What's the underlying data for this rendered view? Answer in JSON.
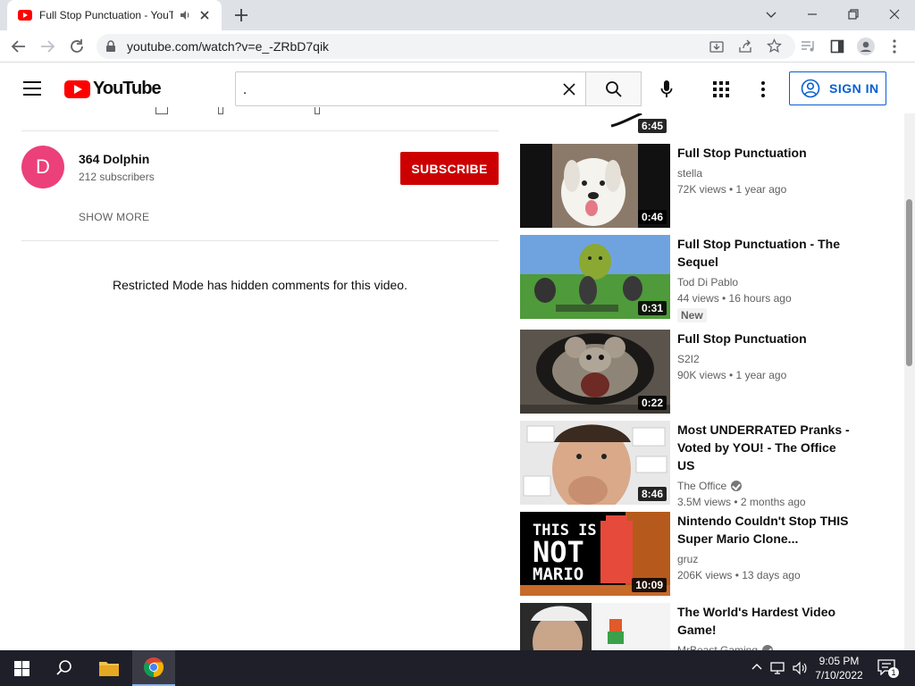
{
  "browser": {
    "tab_title": "Full Stop Punctuation - YouTube",
    "url": "youtube.com/watch?v=e_-ZRbD7qik"
  },
  "youtube": {
    "logo_text": "YouTube",
    "search_value": ".",
    "sign_in_label": "SIGN IN"
  },
  "channel": {
    "avatar_letter": "D",
    "name": "364 Dolphin",
    "subscribers": "212 subscribers",
    "subscribe_label": "SUBSCRIBE",
    "show_more": "SHOW MORE",
    "restricted_message": "Restricted Mode has hidden comments for this video."
  },
  "previous_duration": "6:45",
  "recommendations": [
    {
      "title": "Full Stop Punctuation",
      "channel": "stella",
      "stats": "72K views • 1 year ago",
      "duration": "0:46",
      "verified": false,
      "badge": ""
    },
    {
      "title": "Full Stop Punctuation - The Sequel",
      "channel": "Tod Di Pablo",
      "stats": "44 views • 16 hours ago",
      "duration": "0:31",
      "verified": false,
      "badge": "New"
    },
    {
      "title": "Full Stop Punctuation",
      "channel": "S2I2",
      "stats": "90K views • 1 year ago",
      "duration": "0:22",
      "verified": false,
      "badge": ""
    },
    {
      "title": "Most UNDERRATED Pranks - Voted by YOU! - The Office US",
      "channel": "The Office",
      "stats": "3.5M views • 2 months ago",
      "duration": "8:46",
      "verified": true,
      "badge": ""
    },
    {
      "title": "Nintendo Couldn't Stop THIS Super Mario Clone...",
      "channel": "gruz",
      "stats": "206K views • 13 days ago",
      "duration": "10:09",
      "verified": false,
      "badge": ""
    },
    {
      "title": "The World's Hardest Video Game!",
      "channel": "MrBeast Gaming",
      "stats": "",
      "duration": "",
      "verified": true,
      "badge": ""
    }
  ],
  "thumbnail_text": {
    "mario_line1": "THIS IS",
    "mario_line2": "NOT",
    "mario_line3": "MARIO"
  },
  "taskbar": {
    "time": "9:05 PM",
    "date": "7/10/2022",
    "notification_count": "1"
  }
}
